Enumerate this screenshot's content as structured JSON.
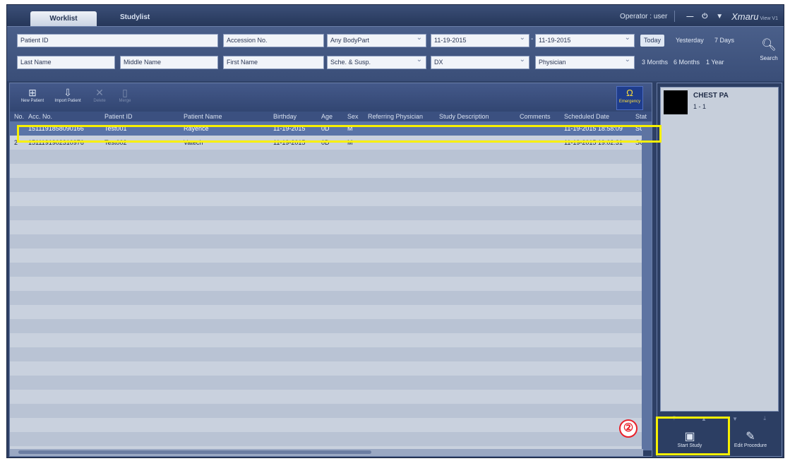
{
  "tabs": {
    "worklist": "Worklist",
    "studylist": "Studylist"
  },
  "operator": "Operator : user",
  "window_controls": {
    "minimize": "—",
    "power": "⏻",
    "menu": "▼"
  },
  "brand": {
    "name": "Xmaru",
    "suffix": "View V1"
  },
  "search": {
    "patient_id": "Patient ID",
    "accession_no": "Accession No.",
    "body_part": "Any BodyPart",
    "date_from": "11-19-2015",
    "date_to": "11-19-2015",
    "last_name": "Last Name",
    "middle_name": "Middle Name",
    "first_name": "First Name",
    "status_filter": "Sche. & Susp.",
    "modality": "DX",
    "physician": "Physician",
    "range_dash": "-",
    "quick": [
      "Today",
      "Yesterday",
      "7 Days",
      "3 Months",
      "6 Months",
      "1 Year"
    ],
    "search_label": "Search"
  },
  "toolbar": {
    "new_patient": "New Patient",
    "import_patient": "Import Patient",
    "delete": "Delete",
    "merge": "Merge",
    "emergency": "Emergency"
  },
  "columns": [
    "No.",
    "Acc. No.",
    "Patient ID",
    "Patient Name",
    "Birthday",
    "Age",
    "Sex",
    "Referring Physician",
    "Study Description",
    "Comments",
    "Scheduled Date",
    "Status"
  ],
  "rows": [
    {
      "no": "",
      "acc": "1511191858090166",
      "pid": "Test001",
      "name": "Rayence",
      "birthday": "11-19-2015",
      "age": "0D",
      "sex": "M",
      "ref": "",
      "desc": "",
      "comments": "",
      "sched": "11-19-2015 18:58:09",
      "status": "SUSP"
    },
    {
      "no": "2",
      "acc": "1511191902310976",
      "pid": "Test002",
      "name": "Vatech",
      "birthday": "11-19-2015",
      "age": "0D",
      "sex": "M",
      "ref": "",
      "desc": "",
      "comments": "",
      "sched": "11-19-2015 19:02:31",
      "status": "SCHE"
    }
  ],
  "procedure": {
    "title": "CHEST PA",
    "count": "1 - 1"
  },
  "right_buttons": {
    "start_study": "Start Study",
    "edit_procedure": "Edit Procedure"
  },
  "annotation": "②",
  "colors": {
    "highlight": "#f7f000",
    "badge": "#e8202a",
    "selected_row": "#5a74a8"
  }
}
